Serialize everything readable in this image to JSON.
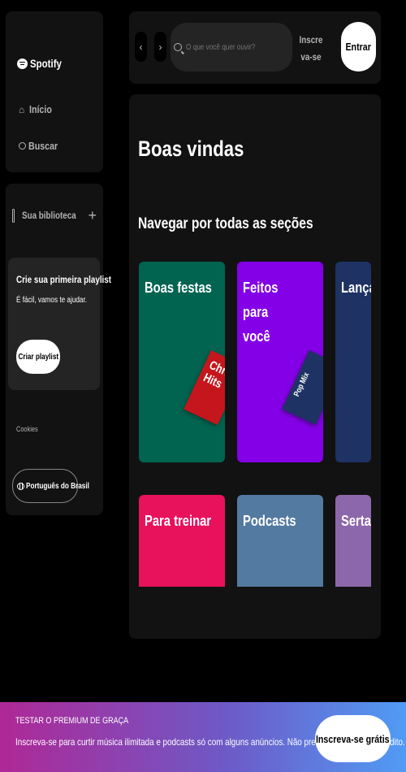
{
  "brand": {
    "logo_text": "Spotify"
  },
  "nav": {
    "items": [
      {
        "label": "Início",
        "icon": "home-icon"
      },
      {
        "label": "Buscar",
        "icon": "search-icon"
      }
    ]
  },
  "library": {
    "title": "Sua biblioteca",
    "add_icon": "plus-icon",
    "create_playlist": {
      "title": "Crie sua primeira playlist",
      "subtitle": "É fácil, vamos te ajudar.",
      "button": "Criar playlist"
    },
    "cookies": "Cookies",
    "language_button": "Português do Brasil"
  },
  "topbar": {
    "back_glyph": "‹",
    "forward_glyph": "›",
    "search_placeholder": "O que você quer ouvir?",
    "signup_label": "Inscreva-se",
    "login_label": "Entrar"
  },
  "main": {
    "welcome": "Boas vindas",
    "section_title": "Navegar por todas as seções",
    "cards": [
      {
        "label": "Boas festas",
        "color": "#006450",
        "cover_text": "Christmas Hits",
        "cover_color": "#c4161c"
      },
      {
        "label": "Feitos para você",
        "color": "#8400e7",
        "cover_text": "Pop Mix",
        "cover_color": "#1e3264"
      },
      {
        "label": "Lançamentos",
        "color": "#1e3264",
        "cover_text": "",
        "cover_color": ""
      },
      {
        "label": "Para treinar",
        "color": "#e8115b",
        "cover_text": "",
        "cover_color": ""
      },
      {
        "label": "Podcasts",
        "color": "#537aa1",
        "cover_text": "",
        "cover_color": ""
      },
      {
        "label": "Sertanejo",
        "color": "#8d67ab",
        "cover_text": "",
        "cover_color": ""
      }
    ]
  },
  "banner": {
    "small": "TESTAR O PREMIUM DE GRAÇA",
    "main": "Inscreva-se para curtir música ilimitada e podcasts só com alguns anúncios. Não precisa de cartão de crédito.",
    "button": "Inscreva-se grátis",
    "gradient_start": "#af2896",
    "gradient_end": "#509bf5"
  }
}
